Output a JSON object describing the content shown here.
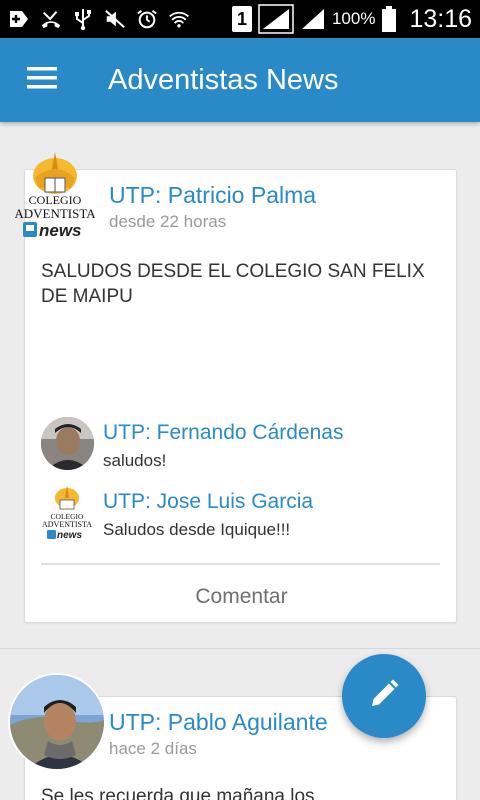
{
  "status_bar": {
    "battery_percent": "100%",
    "sim_slot": "1",
    "time": "13:16"
  },
  "app_bar": {
    "title": "Adventistas News",
    "menu_icon": "hamburger-menu-icon"
  },
  "logo": {
    "line1": "COLEGIO",
    "line2": "ADVENTISTA",
    "badge": "news"
  },
  "posts": [
    {
      "author": "UTP: Patricio Palma",
      "time": "desde 22 horas",
      "body": "SALUDOS DESDE EL COLEGIO SAN FELIX DE MAIPU",
      "comments": [
        {
          "author": "UTP: Fernando Cárdenas",
          "text": "saludos!"
        },
        {
          "author": "UTP: Jose Luis Garcia",
          "text": "Saludos desde Iquique!!!"
        }
      ],
      "comment_action": "Comentar"
    },
    {
      "author": "UTP: Pablo Aguilante",
      "time": "hace 2 días",
      "body": "Se les recuerda que mañana los"
    }
  ],
  "fab": {
    "icon": "pencil-icon"
  },
  "colors": {
    "primary": "#2a8ac8",
    "status_bar": "#000000",
    "background": "#ececec"
  }
}
